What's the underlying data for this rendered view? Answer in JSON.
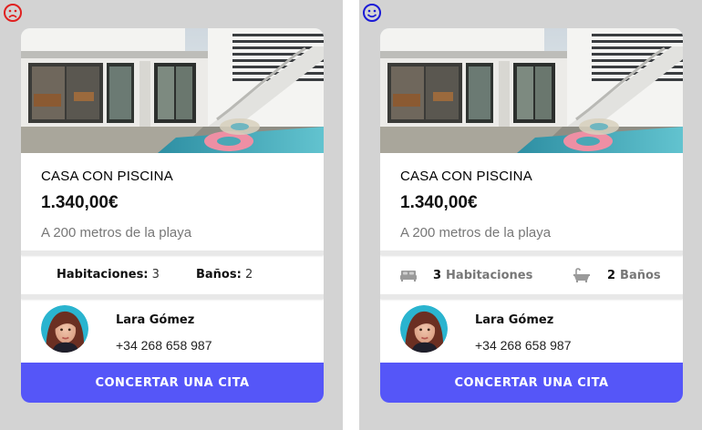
{
  "colors": {
    "background": "#d3d3d3",
    "accent": "#5556f8",
    "bad": "#e0201f",
    "good": "#1a1ad6"
  },
  "left": {
    "face_icon": "sad-face-icon",
    "listing": {
      "title": "CASA CON PISCINA",
      "price": "1.340,00€",
      "description": "A 200 metros de la playa"
    },
    "features": {
      "rooms_label": "Habitaciones:",
      "rooms_value": "3",
      "baths_label": "Baños:",
      "baths_value": "2"
    },
    "agent": {
      "name": "Lara Gómez",
      "phone": "+34 268 658 987"
    },
    "cta_label": "CONCERTAR UNA CITA"
  },
  "right": {
    "face_icon": "happy-face-icon",
    "listing": {
      "title": "CASA CON PISCINA",
      "price": "1.340,00€",
      "description": "A 200 metros de la playa"
    },
    "features": {
      "rooms_value": "3",
      "rooms_label": "Habitaciones",
      "baths_value": "2",
      "baths_label": "Baños",
      "rooms_icon": "bed-icon",
      "baths_icon": "bathtub-icon"
    },
    "agent": {
      "name": "Lara Gómez",
      "phone": "+34 268 658 987"
    },
    "cta_label": "CONCERTAR UNA CITA"
  }
}
